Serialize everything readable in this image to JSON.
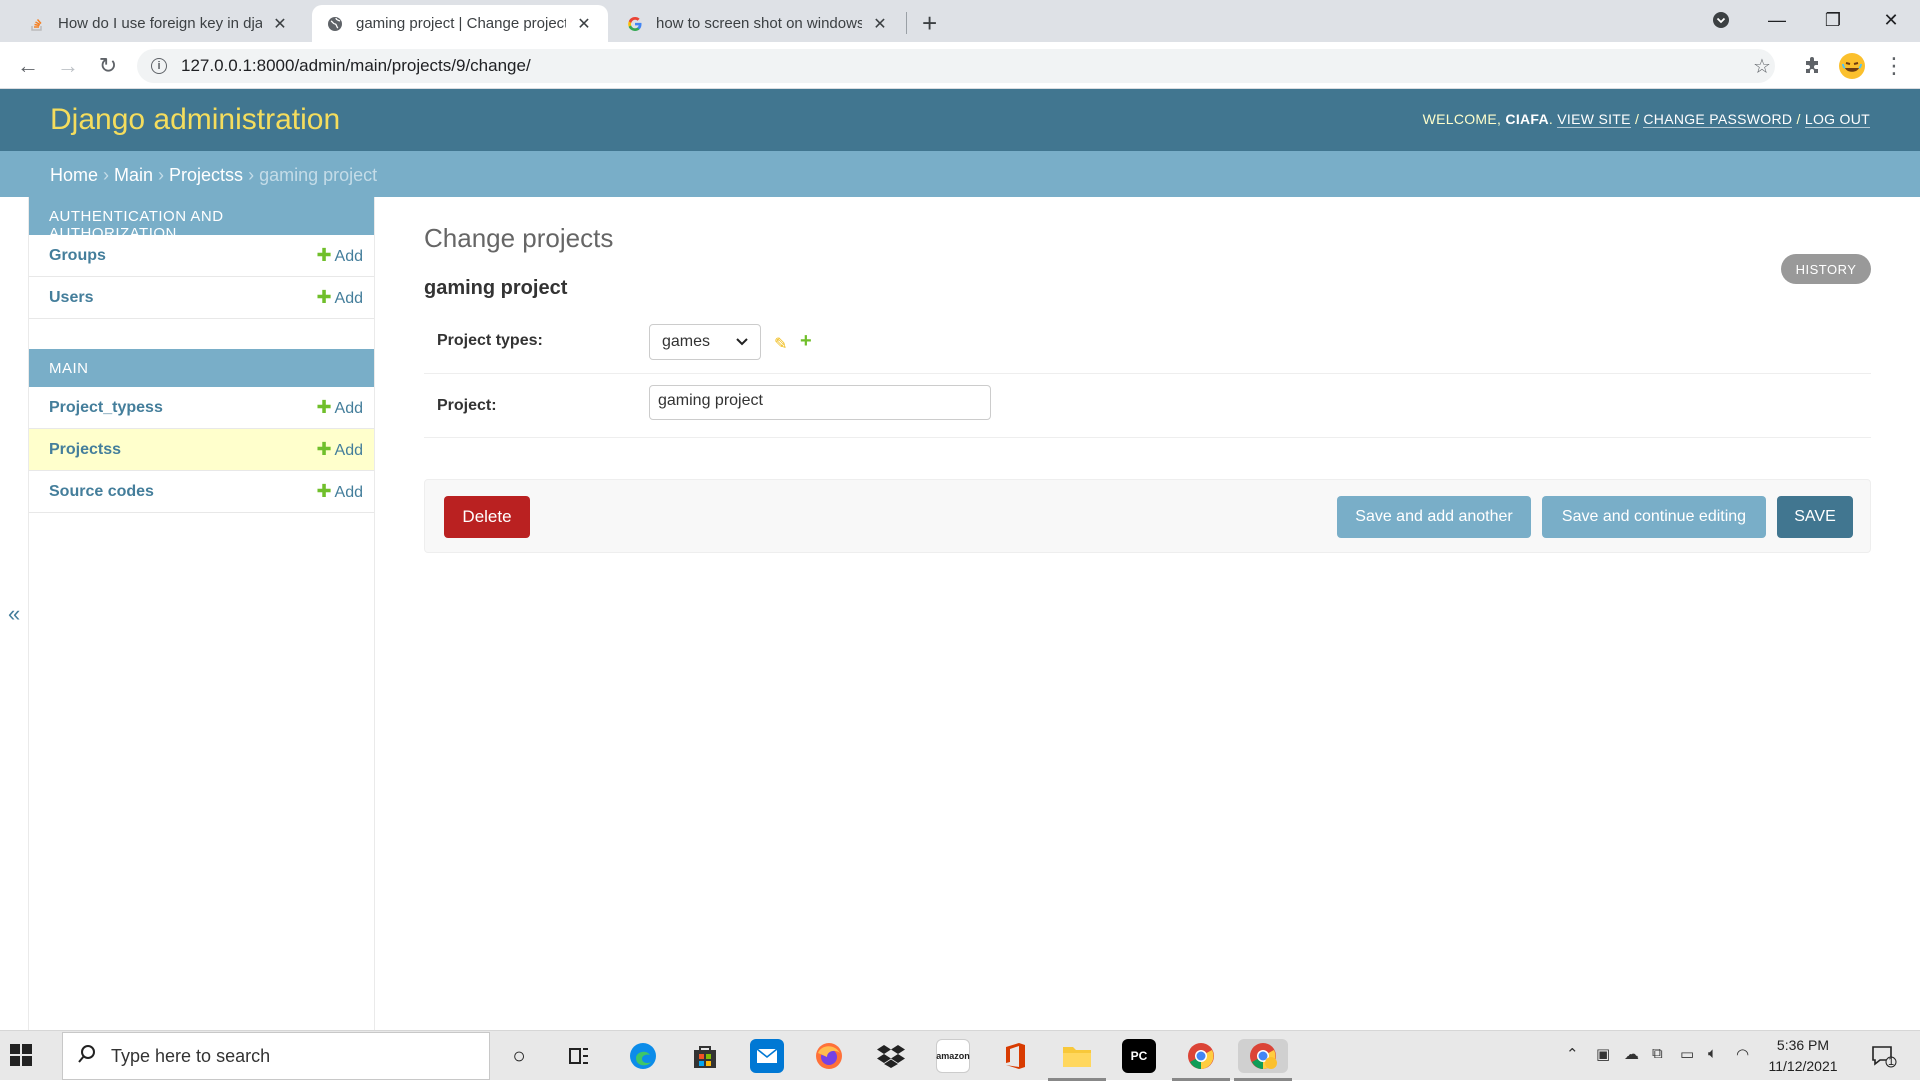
{
  "browser": {
    "tabs": [
      {
        "title": "How do I use foreign key in djang",
        "favicon": "stackoverflow-icon"
      },
      {
        "title": "gaming project | Change projects",
        "favicon": "globe-icon",
        "active": true
      },
      {
        "title": "how to screen shot on windows - ",
        "favicon": "google-icon"
      }
    ],
    "url": "127.0.0.1:8000/admin/main/projects/9/change/"
  },
  "header": {
    "branding": "Django administration",
    "welcome": "WELCOME, ",
    "username": "CIAFA",
    "links": [
      "VIEW SITE",
      "CHANGE PASSWORD",
      "LOG OUT"
    ]
  },
  "breadcrumbs": {
    "items": [
      "Home",
      "Main",
      "Projectss"
    ],
    "current": "gaming project"
  },
  "sidebar": {
    "modules": [
      {
        "caption": "AUTHENTICATION AND AUTHORIZATION",
        "rows": [
          {
            "label": "Groups",
            "add": "Add"
          },
          {
            "label": "Users",
            "add": "Add"
          }
        ]
      },
      {
        "caption": "MAIN",
        "rows": [
          {
            "label": "Project_typess",
            "add": "Add"
          },
          {
            "label": "Projectss",
            "add": "Add",
            "current": true
          },
          {
            "label": "Source codes",
            "add": "Add"
          }
        ]
      }
    ],
    "toggle": "«"
  },
  "content": {
    "title": "Change projects",
    "object_name": "gaming project",
    "history": "HISTORY",
    "fields": {
      "project_types": {
        "label": "Project types:",
        "value": "games"
      },
      "project": {
        "label": "Project:",
        "value": "gaming project"
      }
    },
    "buttons": {
      "delete": "Delete",
      "save_add_another": "Save and add another",
      "save_continue": "Save and continue editing",
      "save": "SAVE"
    }
  },
  "taskbar": {
    "search_placeholder": "Type here to search",
    "time": "5:36 PM",
    "date": "11/12/2021",
    "notifications": "1"
  },
  "colors": {
    "header": "#417690",
    "breadcrumbs": "#79aec8",
    "branding": "#f5dd5d",
    "delete": "#ba2121",
    "add_green": "#70bf2b"
  }
}
